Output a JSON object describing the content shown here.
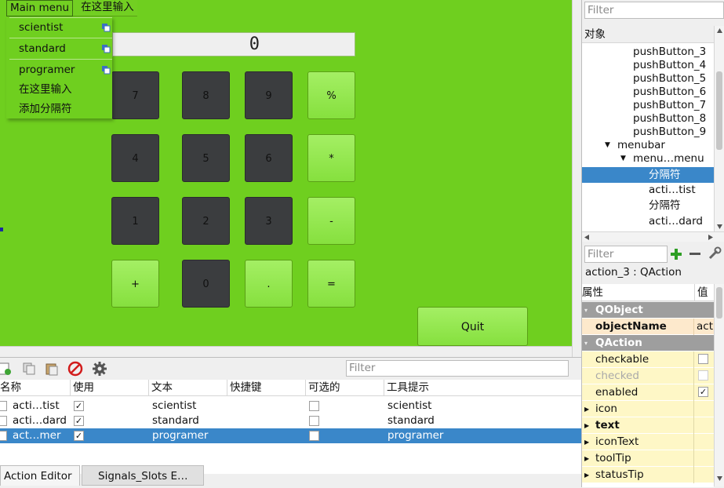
{
  "menubar": {
    "main_menu": "Main menu",
    "type_here": "在这里输入"
  },
  "dropdown": {
    "items": [
      "scientist",
      "standard",
      "programer"
    ],
    "type_here": "在这里输入",
    "add_separator": "添加分隔符"
  },
  "calculator": {
    "display_value": "0",
    "keys": {
      "k7": "7",
      "k8": "8",
      "k9": "9",
      "kpercent": "%",
      "k4": "4",
      "k5": "5",
      "k6": "6",
      "kmul": "*",
      "k1": "1",
      "k2": "2",
      "k3": "3",
      "kminus": "-",
      "kplus": "+",
      "k0": "0",
      "kdot": ".",
      "keq": "="
    },
    "quit": "Quit"
  },
  "action_editor": {
    "filter_placeholder": "Filter",
    "columns": [
      "名称",
      "使用",
      "文本",
      "快捷键",
      "可选的",
      "工具提示"
    ],
    "rows": [
      {
        "name": "acti…tist",
        "used": "✓",
        "text": "scientist",
        "tooltip": "scientist"
      },
      {
        "name": "acti…dard",
        "used": "✓",
        "text": "standard",
        "tooltip": "standard"
      },
      {
        "name": "act…mer",
        "used": "✓",
        "text": "programer",
        "tooltip": "programer"
      }
    ],
    "tabs": [
      "Action Editor",
      "Signals_Slots E…"
    ]
  },
  "object_inspector": {
    "filter_placeholder": "Filter",
    "header": "对象",
    "nodes": [
      "pushButton_3",
      "pushButton_4",
      "pushButton_5",
      "pushButton_6",
      "pushButton_7",
      "pushButton_8",
      "pushButton_9",
      "menubar",
      "menu…menu",
      "分隔符",
      "acti…tist",
      "分隔符",
      "acti…dard"
    ]
  },
  "property_editor": {
    "filter_placeholder": "Filter",
    "class_label": "action_3 : QAction",
    "col_property": "属性",
    "col_value": "值",
    "rows": [
      {
        "name": "QObject"
      },
      {
        "name": "objectName",
        "value": "act"
      },
      {
        "name": "QAction"
      },
      {
        "name": "checkable"
      },
      {
        "name": "checked"
      },
      {
        "name": "enabled",
        "value": "✓"
      },
      {
        "name": "icon"
      },
      {
        "name": "text"
      },
      {
        "name": "iconText"
      },
      {
        "name": "toolTip"
      },
      {
        "name": "statusTip"
      }
    ]
  },
  "colors": {
    "canvas": "#6fcf1f",
    "key_dark": "#3b3d3f",
    "key_light": "#8fe44a",
    "selection": "#3a87c9",
    "group_header": "#9e9e9e"
  }
}
